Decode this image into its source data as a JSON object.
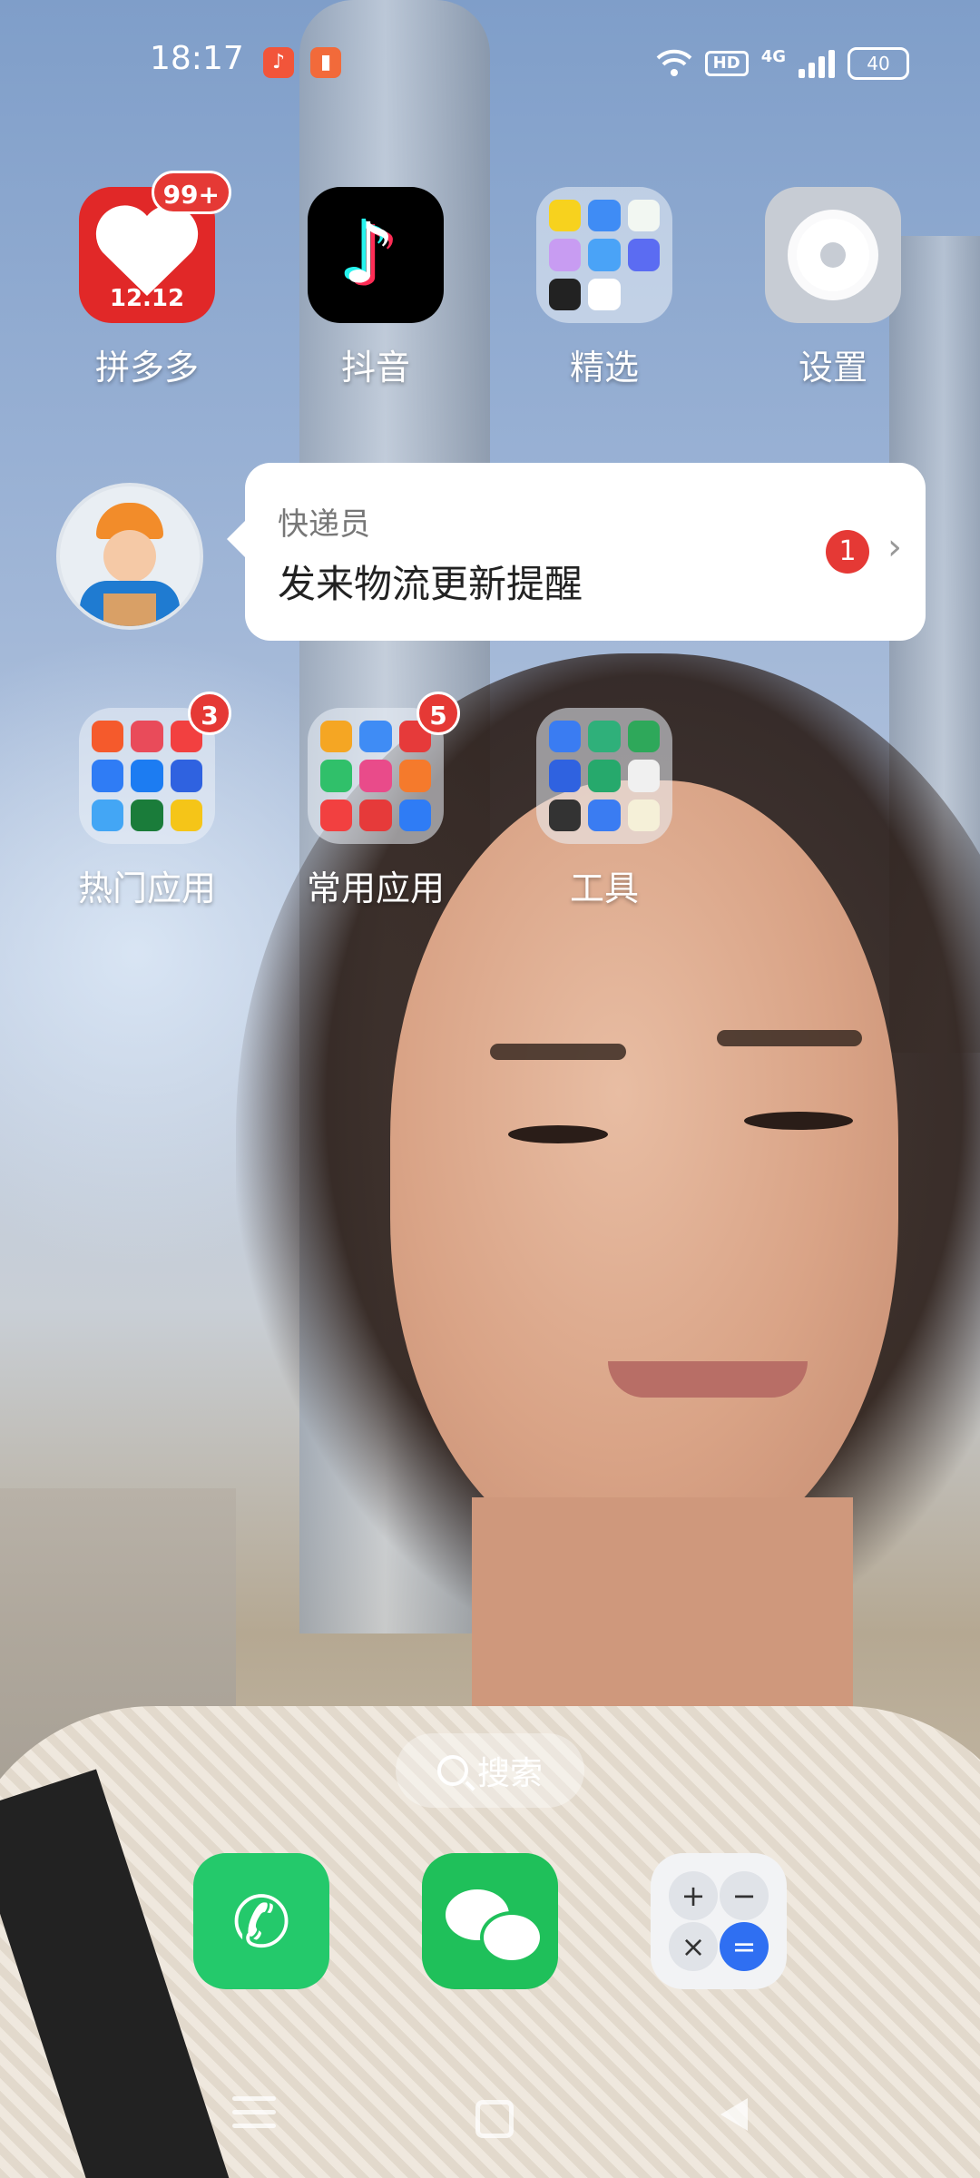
{
  "status_bar": {
    "time": "18:17",
    "hd": "HD",
    "network": "4G",
    "battery": "40"
  },
  "apps": [
    {
      "label": "拼多多",
      "badge": "99+",
      "icon": "pinduoduo-icon",
      "promo": "12.12"
    },
    {
      "label": "抖音",
      "icon": "douyin-icon"
    },
    {
      "label": "精选",
      "icon": "folder-icon"
    },
    {
      "label": "设置",
      "icon": "settings-icon"
    }
  ],
  "notification": {
    "title": "快递员",
    "message": "发来物流更新提醒",
    "count": "1"
  },
  "folders": [
    {
      "label": "热门应用",
      "badge": "3"
    },
    {
      "label": "常用应用",
      "badge": "5"
    },
    {
      "label": "工具"
    }
  ],
  "search": {
    "label": "搜索"
  },
  "dock": [
    {
      "name": "phone",
      "icon": "phone-icon"
    },
    {
      "name": "wechat",
      "icon": "wechat-icon"
    },
    {
      "name": "calculator",
      "icon": "calculator-icon",
      "keys": [
        "+",
        "−",
        "×",
        "="
      ]
    }
  ],
  "colors": {
    "badge": "#e53935",
    "pdd_red": "#e12828",
    "wechat_green": "#1fc05a",
    "phone_green": "#24c96b",
    "calc_accent": "#2f6ff2"
  }
}
